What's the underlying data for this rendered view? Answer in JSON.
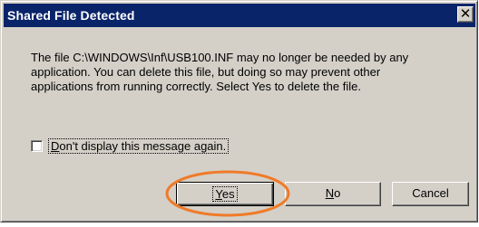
{
  "window": {
    "title": "Shared File Detected"
  },
  "message": {
    "line1": "The file C:\\WINDOWS\\Inf\\USB100.INF may no longer be needed by any",
    "line2": "application. You can delete this file, but doing so may prevent other",
    "line3": "applications from running correctly.  Select Yes to delete the file."
  },
  "checkbox": {
    "label": "Don't display this message again.",
    "checked": false
  },
  "buttons": {
    "yes_label": "Yes",
    "no_label": "No",
    "cancel_label": "Cancel"
  },
  "colors": {
    "titlebar": "#0a246a",
    "dialog_face": "#d4d0c8",
    "highlight": "#f07a28"
  },
  "icons": {
    "close": "close-icon"
  }
}
